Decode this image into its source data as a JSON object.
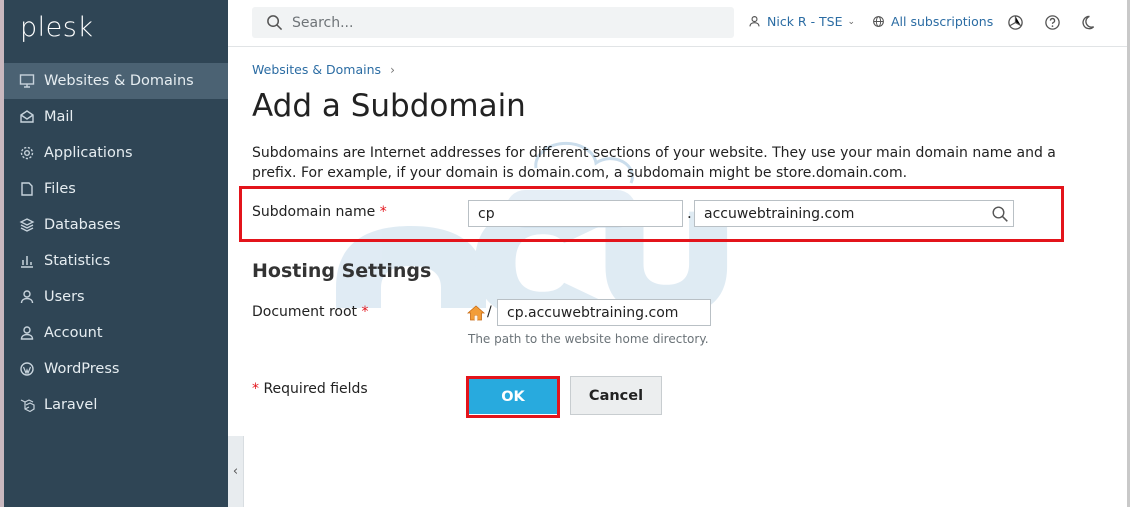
{
  "app": {
    "logo_text": "plesk"
  },
  "sidebar": {
    "items": [
      {
        "label": "Websites & Domains",
        "icon": "monitor-icon",
        "active": true
      },
      {
        "label": "Mail",
        "icon": "mail-icon"
      },
      {
        "label": "Applications",
        "icon": "gear-icon"
      },
      {
        "label": "Files",
        "icon": "file-icon"
      },
      {
        "label": "Databases",
        "icon": "database-icon"
      },
      {
        "label": "Statistics",
        "icon": "bar-chart-icon"
      },
      {
        "label": "Users",
        "icon": "user-icon"
      },
      {
        "label": "Account",
        "icon": "account-icon"
      },
      {
        "label": "WordPress",
        "icon": "wordpress-icon"
      },
      {
        "label": "Laravel",
        "icon": "laravel-icon"
      }
    ],
    "collapse_glyph": "‹"
  },
  "topbar": {
    "search_placeholder": "Search...",
    "user_label": "Nick R - TSE",
    "subscriptions_label": "All subscriptions",
    "icons": [
      "user-icon",
      "globe-icon",
      "cube-icon",
      "help-icon",
      "moon-icon"
    ]
  },
  "breadcrumb": {
    "item": "Websites & Domains",
    "separator": "›"
  },
  "page": {
    "title": "Add a Subdomain",
    "description": "Subdomains are Internet addresses for different sections of your website. They use your main domain name and a prefix. For example, if your domain is domain.com, a subdomain might be store.domain.com."
  },
  "form": {
    "subdomain_label": "Subdomain name",
    "required_mark": "*",
    "subdomain_value": "cp",
    "dot": ".",
    "domain_value": "accuwebtraining.com",
    "hosting_section_title": "Hosting Settings",
    "docroot_label": "Document root",
    "docroot_slash": "/",
    "docroot_value": "cp.accuwebtraining.com",
    "docroot_hint": "The path to the website home directory.",
    "required_fields_label": "Required fields"
  },
  "buttons": {
    "ok": "OK",
    "cancel": "Cancel"
  },
  "colors": {
    "accent": "#28aade",
    "highlight": "#e3141b",
    "sidebar": "#2f4555",
    "link": "#2b6ca3"
  }
}
